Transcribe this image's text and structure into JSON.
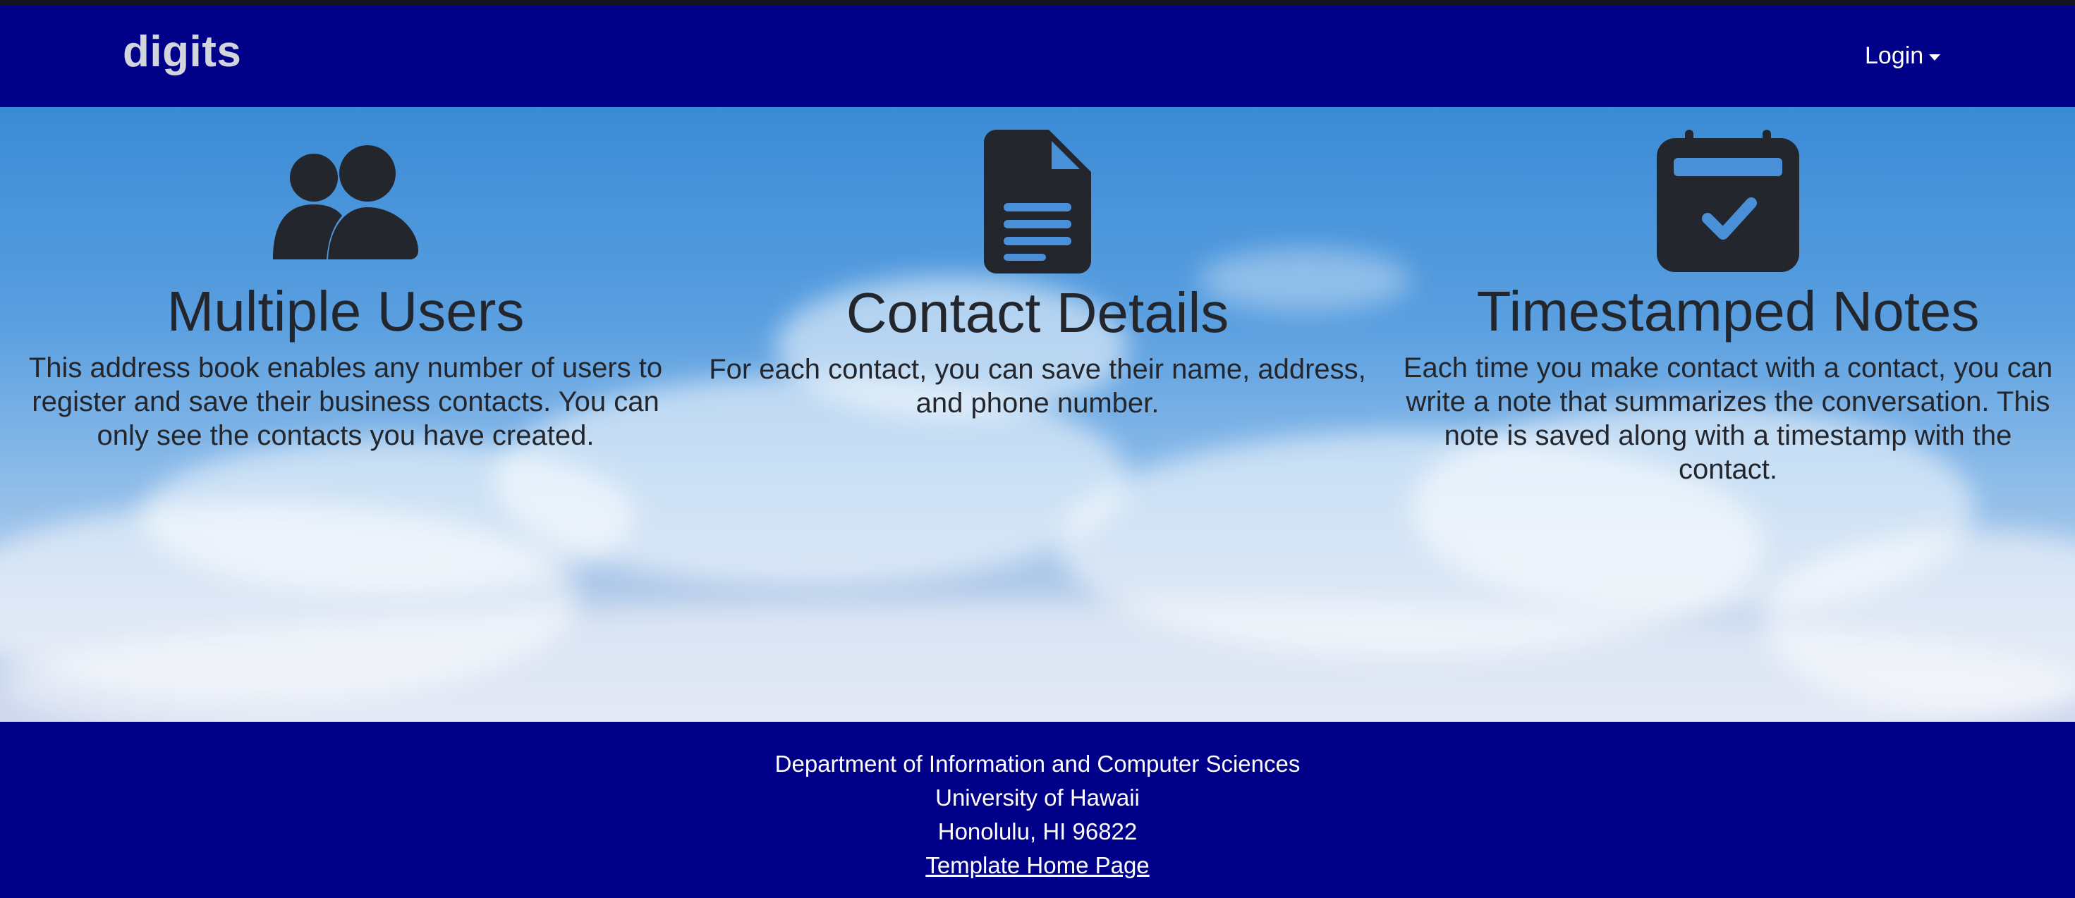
{
  "navbar": {
    "brand": "digits",
    "login_label": "Login"
  },
  "features": [
    {
      "icon": "users-icon",
      "title": "Multiple Users",
      "text": "This address book enables any number of users to register and save their business contacts. You can only see the contacts you have created."
    },
    {
      "icon": "file-lines-icon",
      "title": "Contact Details",
      "text": "For each contact, you can save their name, address, and phone number."
    },
    {
      "icon": "calendar-check-icon",
      "title": "Timestamped Notes",
      "text": "Each time you make contact with a contact, you can write a note that summarizes the conversation. This note is saved along with a timestamp with the contact."
    }
  ],
  "footer": {
    "line1": "Department of Information and Computer Sciences",
    "line2": "University of Hawaii",
    "line3": "Honolulu, HI 96822",
    "link": "Template Home Page"
  },
  "colors": {
    "navbar_bg": "#000088",
    "footer_bg": "#000088",
    "text_dark": "#23262c",
    "icon_accent": "#4a90d9"
  }
}
